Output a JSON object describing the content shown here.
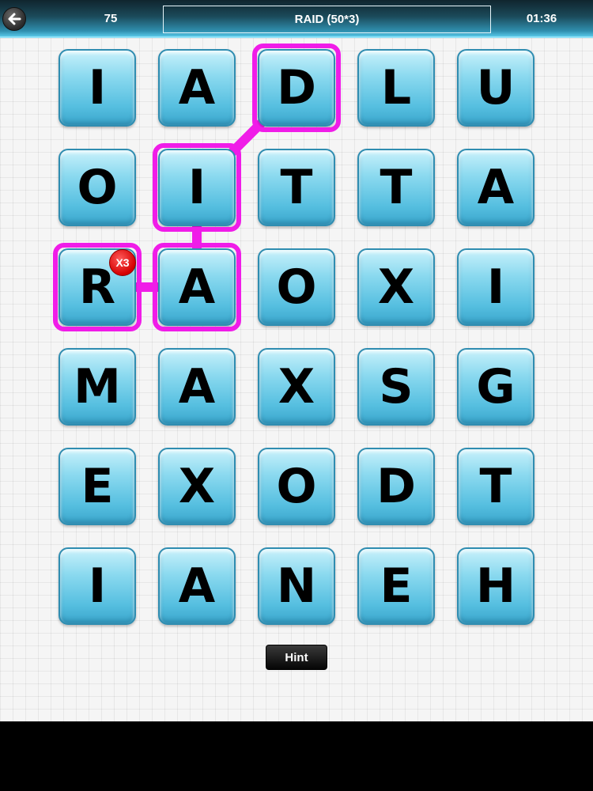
{
  "header": {
    "score": "75",
    "current_word": "RAID (50*3)",
    "timer": "01:36",
    "back_icon": "arrow-left-icon"
  },
  "grid": {
    "rows": [
      [
        "I",
        "A",
        "D",
        "L",
        "U"
      ],
      [
        "O",
        "I",
        "T",
        "T",
        "A"
      ],
      [
        "R",
        "A",
        "O",
        "X",
        "I"
      ],
      [
        "M",
        "A",
        "X",
        "S",
        "G"
      ],
      [
        "E",
        "X",
        "O",
        "D",
        "T"
      ],
      [
        "I",
        "A",
        "N",
        "E",
        "H"
      ]
    ],
    "selected_path": [
      [
        2,
        0
      ],
      [
        2,
        1
      ],
      [
        1,
        1
      ],
      [
        0,
        2
      ]
    ],
    "multiplier_badge": {
      "label": "X3",
      "row": 2,
      "col": 0
    }
  },
  "buttons": {
    "hint_label": "Hint"
  },
  "colors": {
    "selection": "#f01ce8",
    "tile": "#56bfe0",
    "badge": "#d40000"
  }
}
